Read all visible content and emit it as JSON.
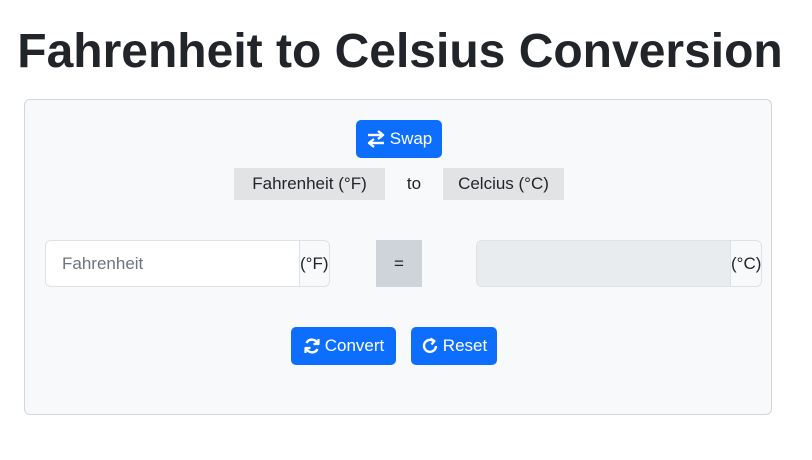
{
  "header": {
    "title": "Fahrenheit to Celsius Conversion"
  },
  "converter": {
    "swap_label": "Swap",
    "swap_icon": "swap-arrows-icon",
    "from_unit_label": "Fahrenheit (°F)",
    "to_word": "to",
    "to_unit_label": "Celcius (°C)",
    "input": {
      "value": "",
      "placeholder": "Fahrenheit",
      "unit": "(°F)"
    },
    "equals_label": "=",
    "output": {
      "value": "",
      "unit": "(°C)"
    },
    "convert_label": "Convert",
    "convert_icon": "refresh-icon",
    "reset_label": "Reset",
    "reset_icon": "reset-icon"
  },
  "colors": {
    "primary": "#0d6efd",
    "card_background": "#f8f9fa",
    "label_background": "#e2e3e5",
    "equals_background": "#ced4da",
    "readonly_background": "#e9ecef"
  }
}
